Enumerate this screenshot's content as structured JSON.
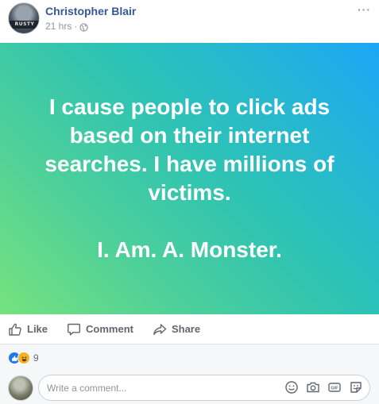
{
  "post": {
    "author": "Christopher Blair",
    "timestamp": "21 hrs",
    "separator": "·",
    "privacy_icon": "globe-icon",
    "avatar_band_text": "RUSTY",
    "more_label": "···",
    "status_lines": [
      "I cause people to click ads",
      "based on their internet",
      "searches. I have millions of",
      "victims.",
      "I. Am. A. Monster."
    ],
    "background_colors": [
      "#76e27e",
      "#1ea5f7"
    ],
    "text_color": "#ffffff"
  },
  "actions": {
    "like_label": "Like",
    "comment_label": "Comment",
    "share_label": "Share"
  },
  "reactions": {
    "icons": [
      "like-reaction-icon",
      "haha-reaction-icon"
    ],
    "count": "9"
  },
  "comment": {
    "placeholder": "Write a comment...",
    "icons": [
      "emoji-icon",
      "camera-icon",
      "gif-icon",
      "sticker-icon"
    ]
  },
  "colors": {
    "author_link": "#365899",
    "muted": "#90949c",
    "action_text": "#606770",
    "like_blue": "#2078f4"
  }
}
